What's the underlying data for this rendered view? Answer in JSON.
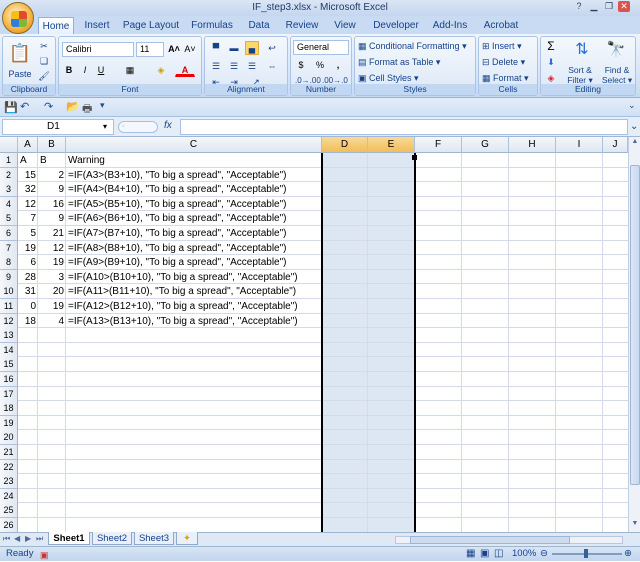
{
  "window": {
    "title": "IF_step3.xlsx - Microsoft Excel"
  },
  "tabs": [
    "Home",
    "Insert",
    "Page Layout",
    "Formulas",
    "Data",
    "Review",
    "View",
    "Developer",
    "Add-Ins",
    "Acrobat"
  ],
  "ribbon": {
    "clipboard": {
      "paste": "Paste",
      "label": "Clipboard"
    },
    "font": {
      "name": "Calibri",
      "size": "11",
      "label": "Font",
      "bold": "B",
      "italic": "I",
      "underline": "U"
    },
    "alignment": {
      "label": "Alignment"
    },
    "number": {
      "format": "General",
      "label": "Number",
      "currency": "$",
      "percent": "%",
      "comma": ","
    },
    "styles": {
      "conditional": "Conditional Formatting",
      "table": "Format as Table",
      "cell": "Cell Styles",
      "label": "Styles"
    },
    "cells": {
      "insert": "Insert",
      "delete": "Delete",
      "format": "Format",
      "label": "Cells"
    },
    "editing": {
      "sigma": "Σ",
      "sort": "Sort &",
      "filter": "Filter",
      "find": "Find &",
      "select": "Select",
      "label": "Editing"
    }
  },
  "namebox": "D1",
  "fx": "fx",
  "columns": [
    "A",
    "B",
    "C",
    "D",
    "E",
    "F",
    "G",
    "H",
    "I",
    "J"
  ],
  "rows": [
    {
      "n": "1",
      "a": "A",
      "b": "B",
      "c": "Warning"
    },
    {
      "n": "2",
      "a": "15",
      "b": "2",
      "c": "=IF(A3>(B3+10), \"To big a spread\", \"Acceptable\")"
    },
    {
      "n": "3",
      "a": "32",
      "b": "9",
      "c": "=IF(A4>(B4+10), \"To big a spread\", \"Acceptable\")"
    },
    {
      "n": "4",
      "a": "12",
      "b": "16",
      "c": "=IF(A5>(B5+10), \"To big a spread\", \"Acceptable\")"
    },
    {
      "n": "5",
      "a": "7",
      "b": "9",
      "c": "=IF(A6>(B6+10), \"To big a spread\", \"Acceptable\")"
    },
    {
      "n": "6",
      "a": "5",
      "b": "21",
      "c": "=IF(A7>(B7+10), \"To big a spread\", \"Acceptable\")"
    },
    {
      "n": "7",
      "a": "19",
      "b": "12",
      "c": "=IF(A8>(B8+10), \"To big a spread\", \"Acceptable\")"
    },
    {
      "n": "8",
      "a": "6",
      "b": "19",
      "c": "=IF(A9>(B9+10), \"To big a spread\", \"Acceptable\")"
    },
    {
      "n": "9",
      "a": "28",
      "b": "3",
      "c": "=IF(A10>(B10+10), \"To big a spread\", \"Acceptable\")"
    },
    {
      "n": "10",
      "a": "31",
      "b": "20",
      "c": "=IF(A11>(B11+10), \"To big a spread\", \"Acceptable\")"
    },
    {
      "n": "11",
      "a": "0",
      "b": "19",
      "c": "=IF(A12>(B12+10), \"To big a spread\", \"Acceptable\")"
    },
    {
      "n": "12",
      "a": "18",
      "b": "4",
      "c": "=IF(A13>(B13+10), \"To big a spread\", \"Acceptable\")"
    },
    {
      "n": "13",
      "a": "",
      "b": "",
      "c": ""
    },
    {
      "n": "14",
      "a": "",
      "b": "",
      "c": ""
    },
    {
      "n": "15",
      "a": "",
      "b": "",
      "c": ""
    },
    {
      "n": "16",
      "a": "",
      "b": "",
      "c": ""
    },
    {
      "n": "17",
      "a": "",
      "b": "",
      "c": ""
    },
    {
      "n": "18",
      "a": "",
      "b": "",
      "c": ""
    },
    {
      "n": "19",
      "a": "",
      "b": "",
      "c": ""
    },
    {
      "n": "20",
      "a": "",
      "b": "",
      "c": ""
    },
    {
      "n": "21",
      "a": "",
      "b": "",
      "c": ""
    },
    {
      "n": "22",
      "a": "",
      "b": "",
      "c": ""
    },
    {
      "n": "23",
      "a": "",
      "b": "",
      "c": ""
    },
    {
      "n": "24",
      "a": "",
      "b": "",
      "c": ""
    },
    {
      "n": "25",
      "a": "",
      "b": "",
      "c": ""
    },
    {
      "n": "26",
      "a": "",
      "b": "",
      "c": ""
    }
  ],
  "sheets": [
    "Sheet1",
    "Sheet2",
    "Sheet3"
  ],
  "status": {
    "ready": "Ready",
    "zoom": "100%"
  }
}
